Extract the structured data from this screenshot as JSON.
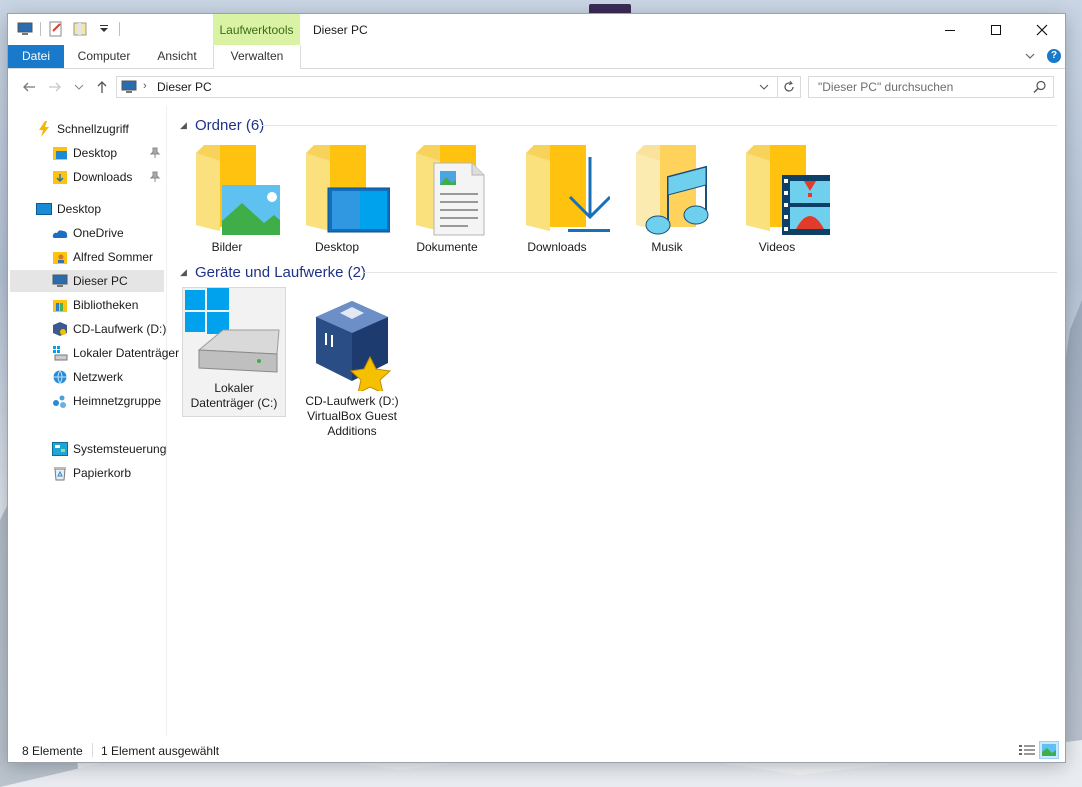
{
  "window": {
    "title": "Dieser PC",
    "context_tab_group": "Laufwerktools"
  },
  "ribbon": {
    "tabs": [
      {
        "label": "Datei"
      },
      {
        "label": "Computer"
      },
      {
        "label": "Ansicht"
      },
      {
        "label": "Verwalten"
      }
    ],
    "help": "?"
  },
  "address": {
    "path": "Dieser PC",
    "search_placeholder": "\"Dieser PC\" durchsuchen"
  },
  "nav": {
    "quick_access": "Schnellzugriff",
    "quick_items": [
      {
        "label": "Desktop",
        "icon": "folder-desktop-icon"
      },
      {
        "label": "Downloads",
        "icon": "folder-downloads-icon"
      }
    ],
    "items": [
      {
        "label": "Desktop",
        "icon": "desktop-icon"
      },
      {
        "label": "OneDrive",
        "icon": "onedrive-icon"
      },
      {
        "label": "Alfred Sommer",
        "icon": "user-folder-icon"
      },
      {
        "label": "Dieser PC",
        "icon": "computer-icon"
      },
      {
        "label": "Bibliotheken",
        "icon": "libraries-icon"
      },
      {
        "label": "CD-Laufwerk (D:)",
        "icon": "cd-drive-icon"
      },
      {
        "label": "Lokaler Datenträger",
        "icon": "drive-icon"
      },
      {
        "label": "Netzwerk",
        "icon": "network-icon"
      },
      {
        "label": "Heimnetzgruppe",
        "icon": "homegroup-icon"
      },
      {
        "label": "Systemsteuerung",
        "icon": "control-panel-icon"
      },
      {
        "label": "Papierkorb",
        "icon": "recycle-bin-icon"
      }
    ]
  },
  "groups": {
    "folders_title": "Ordner (6)",
    "devices_title": "Geräte und Laufwerke (2)"
  },
  "folders": [
    {
      "label": "Bilder",
      "icon": "pictures-folder-icon"
    },
    {
      "label": "Desktop",
      "icon": "desktop-folder-icon"
    },
    {
      "label": "Dokumente",
      "icon": "documents-folder-icon"
    },
    {
      "label": "Downloads",
      "icon": "downloads-folder-icon"
    },
    {
      "label": "Musik",
      "icon": "music-folder-icon"
    },
    {
      "label": "Videos",
      "icon": "videos-folder-icon"
    }
  ],
  "drives": [
    {
      "line1": "Lokaler",
      "line2": "Datenträger (C:)",
      "line3": "",
      "icon": "windows-drive-icon"
    },
    {
      "line1": "CD-Laufwerk (D:)",
      "line2": "VirtualBox Guest",
      "line3": "Additions",
      "icon": "virtualbox-cd-icon"
    }
  ],
  "status": {
    "count": "8 Elemente",
    "selection": "1 Element ausgewählt"
  },
  "colors": {
    "accent": "#1979ca",
    "context_tab": "#d9f2a4",
    "group_header": "#1e3287",
    "folder_yellow": "#ffc20e"
  }
}
